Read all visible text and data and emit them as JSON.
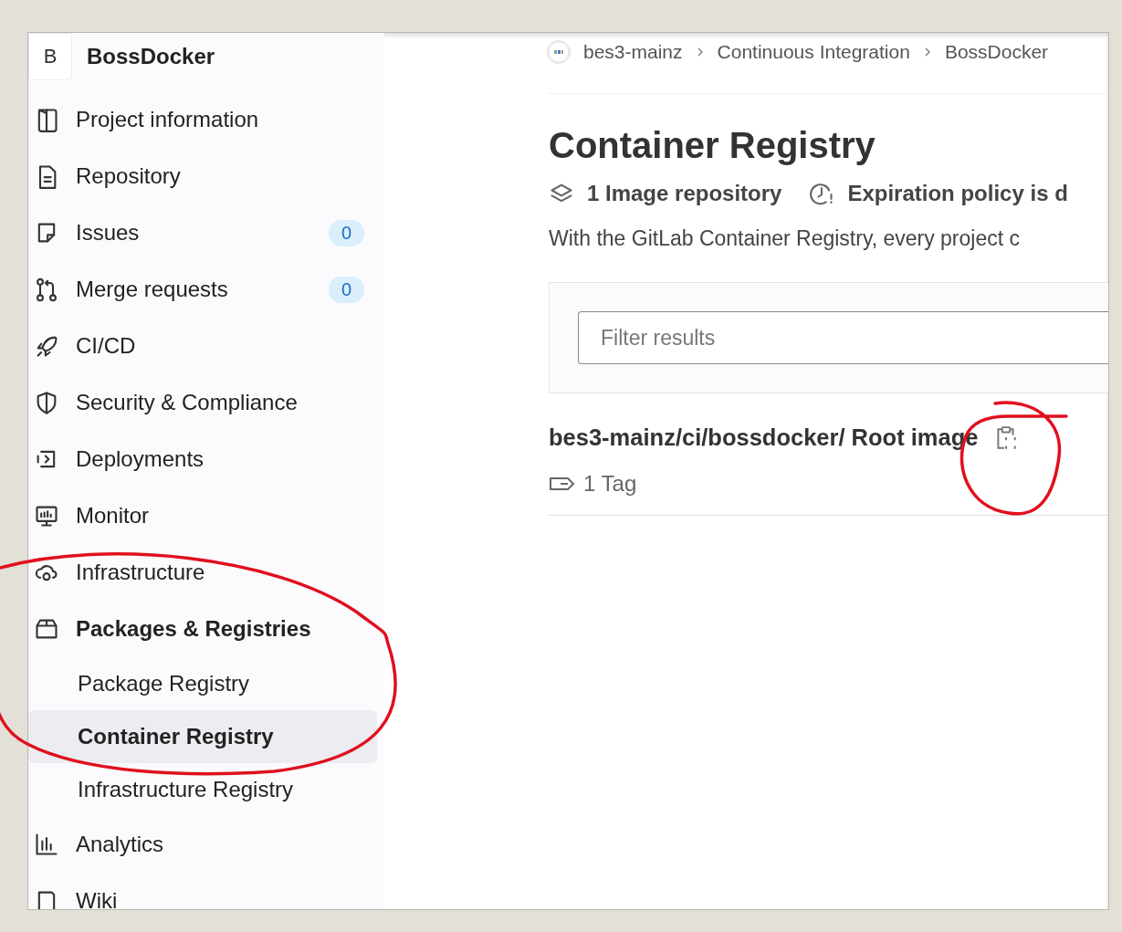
{
  "project": {
    "avatar": "B",
    "name": "BossDocker"
  },
  "sidebar": {
    "items": [
      {
        "kind": "document-half",
        "label": "Project information",
        "selected": false
      },
      {
        "kind": "file",
        "label": "Repository",
        "selected": false
      },
      {
        "kind": "issues",
        "label": "Issues",
        "badge": "0",
        "selected": false
      },
      {
        "kind": "merge",
        "label": "Merge requests",
        "badge": "0",
        "selected": false
      },
      {
        "kind": "rocket",
        "label": "CI/CD",
        "selected": false
      },
      {
        "kind": "shield",
        "label": "Security & Compliance",
        "selected": false
      },
      {
        "kind": "deploy",
        "label": "Deployments",
        "selected": false
      },
      {
        "kind": "monitor",
        "label": "Monitor",
        "selected": false
      },
      {
        "kind": "cloud-gear",
        "label": "Infrastructure",
        "selected": false
      },
      {
        "kind": "package",
        "label": "Packages & Registries",
        "selected": false,
        "expanded": true,
        "children": [
          {
            "label": "Package Registry",
            "selected": false
          },
          {
            "label": "Container Registry",
            "selected": true
          },
          {
            "label": "Infrastructure Registry",
            "selected": false
          }
        ]
      },
      {
        "kind": "chart",
        "label": "Analytics",
        "selected": false
      },
      {
        "kind": "book",
        "label": "Wiki",
        "selected": false
      }
    ]
  },
  "breadcrumbs": [
    "bes3-mainz",
    "Continuous Integration",
    "BossDocker"
  ],
  "page_title": "Container Registry",
  "stats": [
    {
      "kind": "layers",
      "text": "1 Image repository"
    },
    {
      "kind": "clock",
      "text": "Expiration policy is d"
    }
  ],
  "description": "With the GitLab Container Registry, every project c",
  "filter": {
    "placeholder": "Filter results"
  },
  "images": [
    {
      "path": "bes3-mainz/ci/bossdocker/ Root image",
      "tags": "1 Tag"
    }
  ]
}
